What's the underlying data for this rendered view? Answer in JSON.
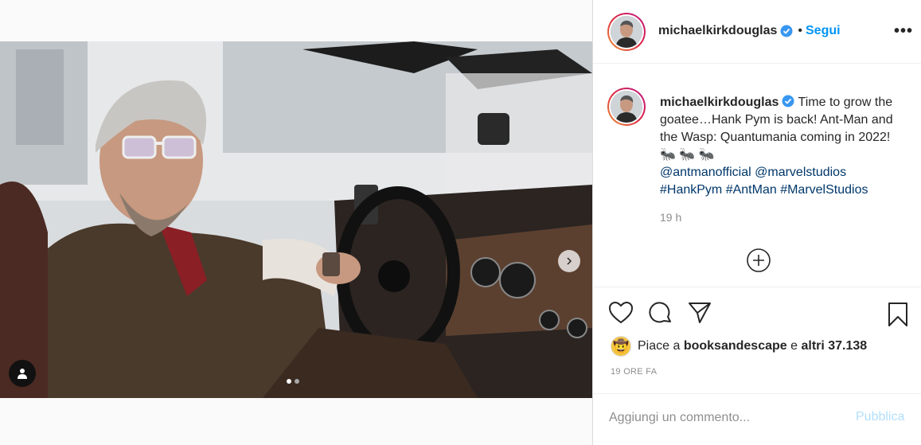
{
  "post": {
    "username": "michaelkirkdouglas",
    "separator": "•",
    "follow_label": "Segui",
    "more_label": "•••",
    "caption": {
      "text": "Time to grow the goatee…Hank Pym is back! Ant-Man and the Wasp: Quantumania coming in 2022! 🐜 🐜 🐜",
      "mention1": "@antmanofficial",
      "mention2": "@marvelstudios",
      "hashtag1": "#HankPym",
      "hashtag2": "#AntMan",
      "hashtag3": "#MarvelStudios"
    },
    "caption_time": "19 h",
    "likes": {
      "prefix": "Piace a",
      "user": "booksandescape",
      "conj": "e",
      "others": "altri 37.138"
    },
    "posted_ago": "19 ORE FA",
    "comment_placeholder": "Aggiungi un commento...",
    "publish_label": "Pubblica"
  },
  "carousel": {
    "total_slides": 2,
    "current_slide": 1
  },
  "icons": {
    "like": "heart-icon",
    "comment": "comment-icon",
    "share": "send-icon",
    "save": "bookmark-icon",
    "load_more": "plus-circle-icon",
    "tag": "user-tag-icon",
    "next": "chevron-right-icon",
    "verified": "verified-badge-icon"
  },
  "colors": {
    "link": "#00376b",
    "accent": "#0095f6",
    "verified": "#3897f0",
    "muted": "#8e8e8e"
  }
}
